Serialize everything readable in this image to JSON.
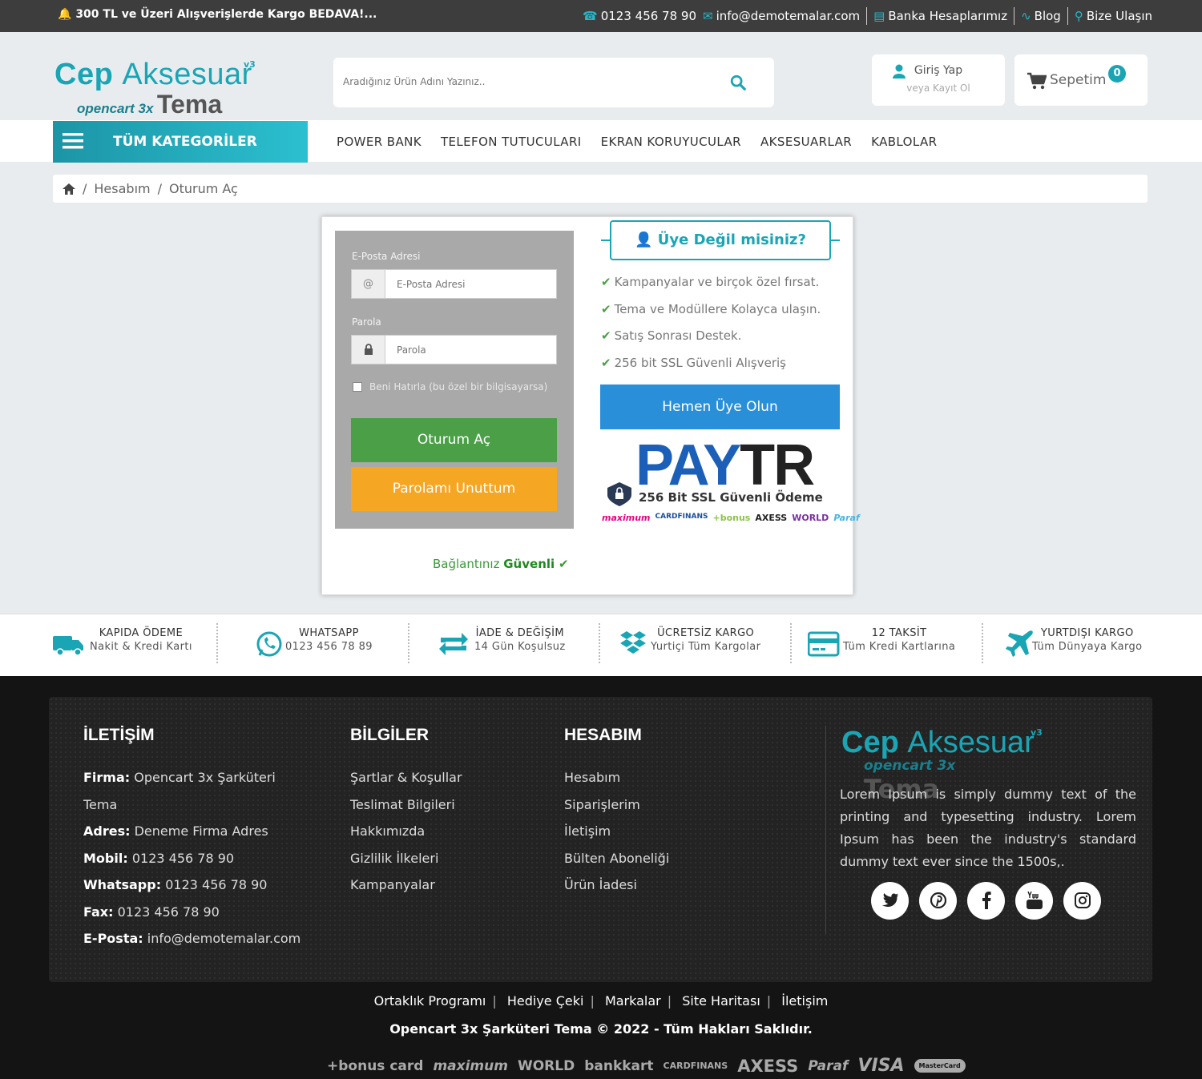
{
  "topbar": {
    "promo": "300 TL ve Üzeri Alışverişlerde Kargo BEDAVA!...",
    "phone": "0123 456 78 90",
    "email": "info@demotemalar.com",
    "bank": "Banka Hesaplarımız",
    "blog": "Blog",
    "contact": "Bize Ulaşın"
  },
  "logo": {
    "word1": "Cep",
    "word2": "Aksesuar",
    "version": "v3",
    "small": "opencart 3x",
    "big": "Tema"
  },
  "search": {
    "placeholder": "Aradığınız Ürün Adını Yazınız.."
  },
  "account": {
    "login": "Giriş Yap",
    "register": "veya Kayıt Ol"
  },
  "cart": {
    "label": "Sepetim",
    "count": "0"
  },
  "nav": {
    "all_categories": "TÜM KATEGORİLER",
    "items": [
      "POWER BANK",
      "TELEFON TUTUCULARI",
      "EKRAN KORUYUCULAR",
      "AKSESUARLAR",
      "KABLOLAR"
    ]
  },
  "breadcrumb": {
    "items": [
      "Hesabım",
      "Oturum Aç"
    ]
  },
  "login_form": {
    "email_label": "E-Posta Adresi",
    "email_placeholder": "E-Posta Adresi",
    "email_addon": "@",
    "password_label": "Parola",
    "password_placeholder": "Parola",
    "remember": "Beni Hatırla (bu özel bir bilgisayarsa)",
    "login_button": "Oturum Aç",
    "forgot_button": "Parolamı Unuttum",
    "secure_prefix": "Bağlantınız",
    "secure_strong": "Güvenli"
  },
  "member": {
    "title": "Üye Değil misiniz?",
    "benefits": [
      "Kampanyalar ve birçok özel fırsat.",
      "Tema ve Modüllere Kolayca ulaşın.",
      "Satış Sonrası Destek.",
      "256 bit SSL Güvenli Alışveriş"
    ],
    "register_button": "Hemen Üye Olun",
    "paytr_pay": "PAY",
    "paytr_tr": "TR",
    "paytr_ssl": "256 Bit SSL Güvenli Ödeme",
    "cards": [
      "maximum",
      "CARDFINANS",
      "+bonus",
      "AXESS",
      "WORLD",
      "Paraf"
    ]
  },
  "features": [
    {
      "title": "KAPIDA ÖDEME",
      "sub": "Nakit & Kredi Kartı",
      "icon": "truck-icon"
    },
    {
      "title": "WHATSAPP",
      "sub": "0123 456 78 89",
      "icon": "whatsapp-icon"
    },
    {
      "title": "İADE & DEĞİŞİM",
      "sub": "14 Gün Koşulsuz",
      "icon": "exchange-icon"
    },
    {
      "title": "ÜCRETSİZ KARGO",
      "sub": "Yurtiçi Tüm Kargolar",
      "icon": "dropbox-icon"
    },
    {
      "title": "12 TAKSİT",
      "sub": "Tüm Kredi Kartlarına",
      "icon": "credit-card-icon"
    },
    {
      "title": "YURTDIŞI KARGO",
      "sub": "Tüm Dünyaya Kargo",
      "icon": "plane-icon"
    }
  ],
  "footer": {
    "contact_title": "İLETİŞİM",
    "contact": [
      {
        "label": "Firma:",
        "value": "Opencart 3x Şarküteri Tema"
      },
      {
        "label": "Adres:",
        "value": "Deneme Firma Adres"
      },
      {
        "label": "Mobil:",
        "value": "0123 456 78 90"
      },
      {
        "label": "Whatsapp:",
        "value": "0123 456 78 90"
      },
      {
        "label": "Fax:",
        "value": "0123 456 78 90"
      },
      {
        "label": "E-Posta:",
        "value": "info@demotemalar.com"
      }
    ],
    "info_title": "BİLGİLER",
    "info": [
      "Şartlar & Koşullar",
      "Teslimat Bilgileri",
      "Hakkımızda",
      "Gizlilik İlkeleri",
      "Kampanyalar"
    ],
    "account_title": "HESABIM",
    "account": [
      "Hesabım",
      "Siparişlerim",
      "İletişim",
      "Bülten Aboneliği",
      "Ürün İadesi"
    ],
    "description": "Lorem Ipsum is simply dummy text of the printing and typesetting industry. Lorem Ipsum has been the industry's standard dummy text ever since the 1500s,.",
    "social": [
      "twitter-icon",
      "pinterest-icon",
      "facebook-icon",
      "youtube-icon",
      "instagram-icon"
    ],
    "bottom_links": [
      "Ortaklık Programı",
      "Hediye Çeki",
      "Markalar",
      "Site Haritası",
      "İletişim"
    ],
    "copyright": "Opencart 3x Şarküteri Tema © 2022 - Tüm Hakları Saklıdır.",
    "payment_logos": [
      "+bonus card",
      "maximum",
      "WORLD",
      "bankkart",
      "CARDFINANS",
      "AXESS",
      "Paraf",
      "VISA",
      "MasterCard"
    ]
  },
  "colors": {
    "accent": "#1aa5b5",
    "green": "#4a9f47",
    "orange": "#f5a623",
    "blue": "#2a8fd9",
    "topbar": "#3d3d3d",
    "footer": "#141414"
  }
}
